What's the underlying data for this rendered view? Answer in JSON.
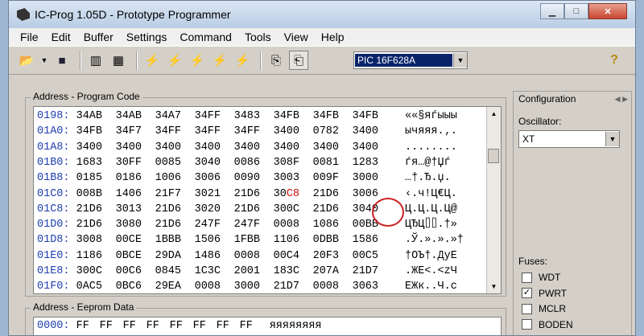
{
  "window": {
    "title": "IC-Prog 1.05D - Prototype Programmer"
  },
  "menu": [
    "File",
    "Edit",
    "Buffer",
    "Settings",
    "Command",
    "Tools",
    "View",
    "Help"
  ],
  "toolbar": {
    "device": "PIC 16F628A",
    "help_label": "?"
  },
  "program": {
    "label": "Address - Program Code",
    "rows": [
      {
        "addr": "0198:",
        "words": [
          "34AB",
          "34AB",
          "34A7",
          "34FF",
          "3483",
          "34FB",
          "34FB",
          "34FB"
        ],
        "ascii": "««§яѓыыы"
      },
      {
        "addr": "01A0:",
        "words": [
          "34FB",
          "34F7",
          "34FF",
          "34FF",
          "34FF",
          "3400",
          "0782",
          "3400"
        ],
        "ascii": "ычяяя.‚."
      },
      {
        "addr": "01A8:",
        "words": [
          "3400",
          "3400",
          "3400",
          "3400",
          "3400",
          "3400",
          "3400",
          "3400"
        ],
        "ascii": "........"
      },
      {
        "addr": "01B0:",
        "words": [
          "1683",
          "30FF",
          "0085",
          "3040",
          "0086",
          "308F",
          "0081",
          "1283"
        ],
        "ascii": "ѓя…@†Џѓ"
      },
      {
        "addr": "01B8:",
        "words": [
          "0185",
          "0186",
          "1006",
          "3006",
          "0090",
          "3003",
          "009F",
          "3000"
        ],
        "ascii": "…†.Ђ.џ."
      },
      {
        "addr": "01C0:",
        "words": [
          "008B",
          "1406",
          "21F7",
          "3021",
          "21D6",
          "30C8",
          "21D6",
          "3006"
        ],
        "ascii": "‹.ч!Ц€Ц."
      },
      {
        "addr": "01C8:",
        "words": [
          "21D6",
          "3013",
          "21D6",
          "3020",
          "21D6",
          "300C",
          "21D6",
          "3040"
        ],
        "ascii": "Ц.Ц.Ц.Ц@"
      },
      {
        "addr": "01D0:",
        "words": [
          "21D6",
          "3080",
          "21D6",
          "247F",
          "247F",
          "0008",
          "1086",
          "00BB"
        ],
        "ascii": "ЦЂЦ⌷⌷.†»"
      },
      {
        "addr": "01D8:",
        "words": [
          "3008",
          "00CE",
          "1BBB",
          "1506",
          "1FBB",
          "1106",
          "0DBB",
          "1586"
        ],
        "ascii": ".Ў.».».»†"
      },
      {
        "addr": "01E0:",
        "words": [
          "1186",
          "0BCE",
          "29DA",
          "1486",
          "0008",
          "00C4",
          "20F3",
          "00C5"
        ],
        "ascii": "†ОЪ†.ДуЕ"
      },
      {
        "addr": "01E8:",
        "words": [
          "300C",
          "00C6",
          "0845",
          "1C3C",
          "2001",
          "183C",
          "207A",
          "21D7"
        ],
        "ascii": ".ЖЕ<.<zЧ"
      },
      {
        "addr": "01F0:",
        "words": [
          "0AC5",
          "0BC6",
          "29EA",
          "0008",
          "3000",
          "21D7",
          "0008",
          "3063"
        ],
        "ascii": "ЕЖк..Ч.c"
      }
    ],
    "highlight_suffix": "C8"
  },
  "eeprom": {
    "label": "Address - Eeprom Data",
    "rows": [
      {
        "addr": "0000:",
        "bytes": [
          "FF",
          "FF",
          "FF",
          "FF",
          "FF",
          "FF",
          "FF",
          "FF"
        ],
        "ascii": "яяяяяяяя"
      }
    ]
  },
  "config": {
    "label": "Configuration",
    "osc_label": "Oscillator:",
    "oscillator": "XT",
    "fuses_label": "Fuses:",
    "fuses": [
      {
        "name": "WDT",
        "checked": false
      },
      {
        "name": "PWRT",
        "checked": true
      },
      {
        "name": "MCLR",
        "checked": false
      },
      {
        "name": "BODEN",
        "checked": false
      }
    ]
  },
  "colors": {
    "address": "#1f3fae",
    "highlight": "#d01010",
    "selection": "#0a246a"
  }
}
